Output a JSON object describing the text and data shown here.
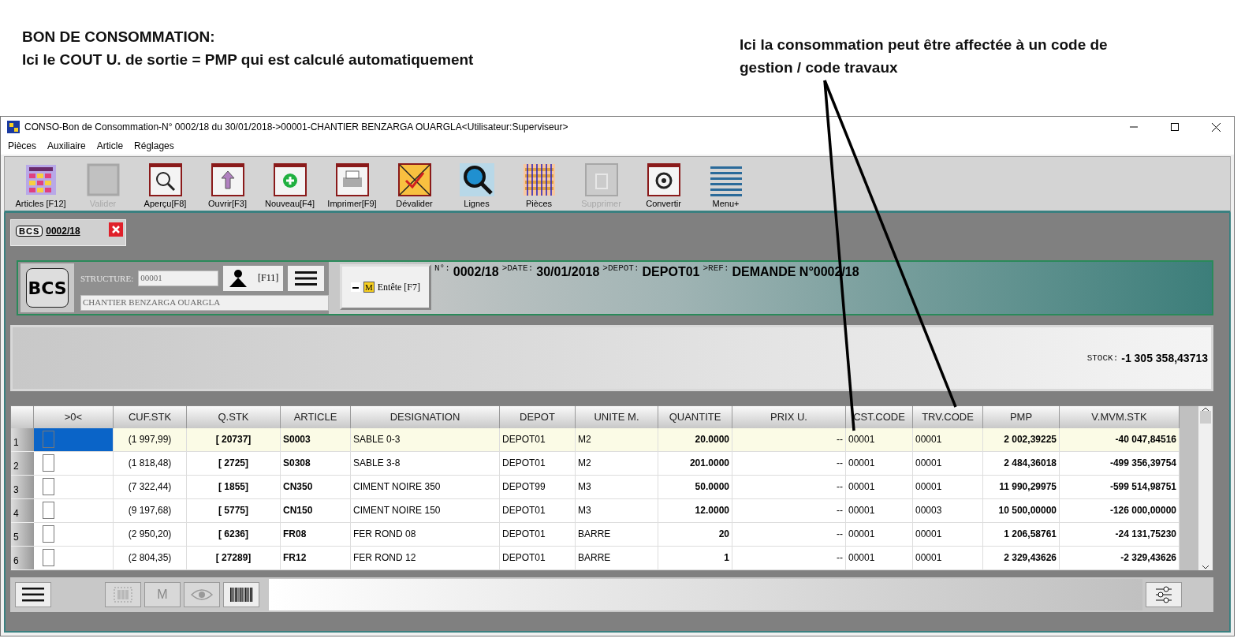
{
  "annotations": {
    "left": {
      "title": "BON DE CONSOMMATION:",
      "text": "Ici le COUT U. de sortie = PMP qui est calculé automatiquement"
    },
    "right": {
      "text": "Ici la consommation peut être affectée à un code de gestion / code travaux"
    }
  },
  "window": {
    "title": "CONSO-Bon de Consommation-N° 0002/18 du 30/01/2018->00001-CHANTIER BENZARGA OUARGLA<Utilisateur:Superviseur>"
  },
  "menu": [
    "Pièces",
    "Auxiliaire",
    "Article",
    "Réglages"
  ],
  "toolbar": [
    {
      "kind": "articles",
      "label": "Articles [F12]",
      "disabled": false
    },
    {
      "kind": "validate",
      "label": "Valider",
      "disabled": true
    },
    {
      "kind": "preview",
      "label": "Aperçu[F8]",
      "disabled": false
    },
    {
      "kind": "open",
      "label": "Ouvrir[F3]",
      "disabled": false
    },
    {
      "kind": "new",
      "label": "Nouveau[F4]",
      "disabled": false
    },
    {
      "kind": "print",
      "label": "Imprimer[F9]",
      "disabled": false
    },
    {
      "kind": "unvalidate",
      "label": "Dévalider",
      "disabled": false
    },
    {
      "kind": "lines",
      "label": "Lignes",
      "disabled": false
    },
    {
      "kind": "pieces",
      "label": "Pièces",
      "disabled": false
    },
    {
      "kind": "delete",
      "label": "Supprimer",
      "disabled": true
    },
    {
      "kind": "convert",
      "label": "Convertir",
      "disabled": false
    },
    {
      "kind": "menu",
      "label": "Menu+",
      "disabled": false
    }
  ],
  "doc_tab": {
    "badge": "BCS",
    "label": "0002/18"
  },
  "header": {
    "badge": "BCS",
    "structure_label": "STRUCTURE:",
    "structure_value": "00001",
    "structure_name": "CHANTIER BENZARGA OUARGLA",
    "user_key": "[F11]",
    "entete": {
      "mark": "M",
      "label": "Entête [F7]"
    },
    "summary": [
      {
        "label": "N°:",
        "value": "0002/18"
      },
      {
        "label": ">DATE:",
        "value": "30/01/2018"
      },
      {
        "label": ">DEPOT:",
        "value": "DEPOT01"
      },
      {
        "label": ">REF:",
        "value": "DEMANDE N°0002/18"
      }
    ]
  },
  "stock": {
    "label": "STOCK:",
    "value": "-1 305 358,43713"
  },
  "grid": {
    "check_column": ">0<",
    "columns": [
      "CUF.STK",
      "Q.STK",
      "ARTICLE",
      "DESIGNATION",
      "DEPOT",
      "UNITE M.",
      "QUANTITE",
      "PRIX U.",
      "CST.CODE",
      "TRV.CODE",
      "PMP",
      "V.MVM.STK"
    ],
    "rows": [
      {
        "number": "1",
        "selected": true,
        "checked": false,
        "cells": [
          "(1 997,99)",
          "[ 20737]",
          "S0003",
          "SABLE 0-3",
          "DEPOT01",
          "M2",
          "20.0000",
          "--",
          "00001",
          "00001",
          "2 002,39225",
          "-40 047,84516"
        ]
      },
      {
        "number": "2",
        "selected": false,
        "checked": false,
        "cells": [
          "(1 818,48)",
          "[ 2725]",
          "S0308",
          "SABLE 3-8",
          "DEPOT01",
          "M2",
          "201.0000",
          "--",
          "00001",
          "00001",
          "2 484,36018",
          "-499 356,39754"
        ]
      },
      {
        "number": "3",
        "selected": false,
        "checked": false,
        "cells": [
          "(7 322,44)",
          "[ 1855]",
          "CN350",
          "CIMENT NOIRE 350",
          "DEPOT99",
          "M3",
          "50.0000",
          "--",
          "00001",
          "00001",
          "11 990,29975",
          "-599 514,98751"
        ]
      },
      {
        "number": "4",
        "selected": false,
        "checked": false,
        "cells": [
          "(9 197,68)",
          "[ 5775]",
          "CN150",
          "CIMENT NOIRE 150",
          "DEPOT01",
          "M3",
          "12.0000",
          "--",
          "00001",
          "00003",
          "10 500,00000",
          "-126 000,00000"
        ]
      },
      {
        "number": "5",
        "selected": false,
        "checked": false,
        "cells": [
          "(2 950,20)",
          "[ 6236]",
          "FR08",
          "FER ROND 08",
          "DEPOT01",
          "BARRE",
          "20",
          "--",
          "00001",
          "00001",
          "1 206,58761",
          "-24 131,75230"
        ]
      },
      {
        "number": "6",
        "selected": false,
        "checked": false,
        "cells": [
          "(2 804,35)",
          "[ 27289]",
          "FR12",
          "FER ROND 12",
          "DEPOT01",
          "BARRE",
          "1",
          "--",
          "00001",
          "00001",
          "2 329,43626",
          "-2 329,43626"
        ]
      }
    ]
  },
  "bottom_bar": {
    "buttons": [
      {
        "kind": "barcode-frame",
        "disabled": true
      },
      {
        "kind": "letter",
        "text": "M",
        "disabled": true
      },
      {
        "kind": "eye",
        "disabled": true
      },
      {
        "kind": "barcode",
        "disabled": false
      }
    ]
  }
}
